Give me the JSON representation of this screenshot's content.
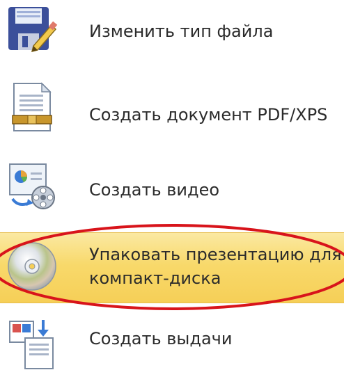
{
  "menu": {
    "items": [
      {
        "label": "Изменить тип файла",
        "icon": "save-as-icon"
      },
      {
        "label": "Создать документ PDF/XPS",
        "icon": "pdf-document-icon"
      },
      {
        "label": "Создать видео",
        "icon": "video-icon"
      },
      {
        "label_line1": "Упаковать презентацию для",
        "label_line2": "компакт-диска",
        "icon": "cd-disc-icon",
        "selected": true
      },
      {
        "label": "Создать выдачи",
        "icon": "handouts-icon"
      }
    ]
  },
  "colors": {
    "highlight": "#f8d96b",
    "annotation": "#d8141b"
  }
}
